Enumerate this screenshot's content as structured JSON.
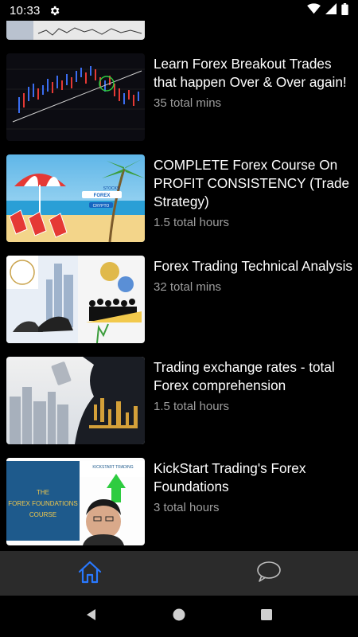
{
  "status_bar": {
    "time": "10:33"
  },
  "courses": [
    {
      "title": "Learn Forex Breakout Trades that happen Over & Over again!",
      "duration": "35 total mins"
    },
    {
      "title": "COMPLETE Forex Course On PROFIT CONSISTENCY (Trade Strategy)",
      "duration": "1.5 total hours"
    },
    {
      "title": "Forex Trading Technical Analysis",
      "duration": "32 total mins"
    },
    {
      "title": "Trading exchange rates - total Forex comprehension",
      "duration": "1.5 total hours"
    },
    {
      "title": "KickStart Trading's Forex Foundations",
      "duration": "3 total hours"
    }
  ],
  "thumb_text": {
    "forex_label": "FOREX",
    "crypto_label": "CRYPTO",
    "stocks_label": "STOCKS",
    "course_the": "THE",
    "course_name": "FOREX FOUNDATIONS",
    "course_word": "COURSE",
    "kickstart": "KICKSTART TRADING"
  },
  "bottom_nav": {
    "active_tab": "home",
    "tabs": [
      "home-icon",
      "chat-icon"
    ]
  },
  "colors": {
    "accent": "#2979ff",
    "background": "#000000",
    "nav_bg": "#2b2b2b",
    "secondary_text": "#9e9e9e"
  }
}
